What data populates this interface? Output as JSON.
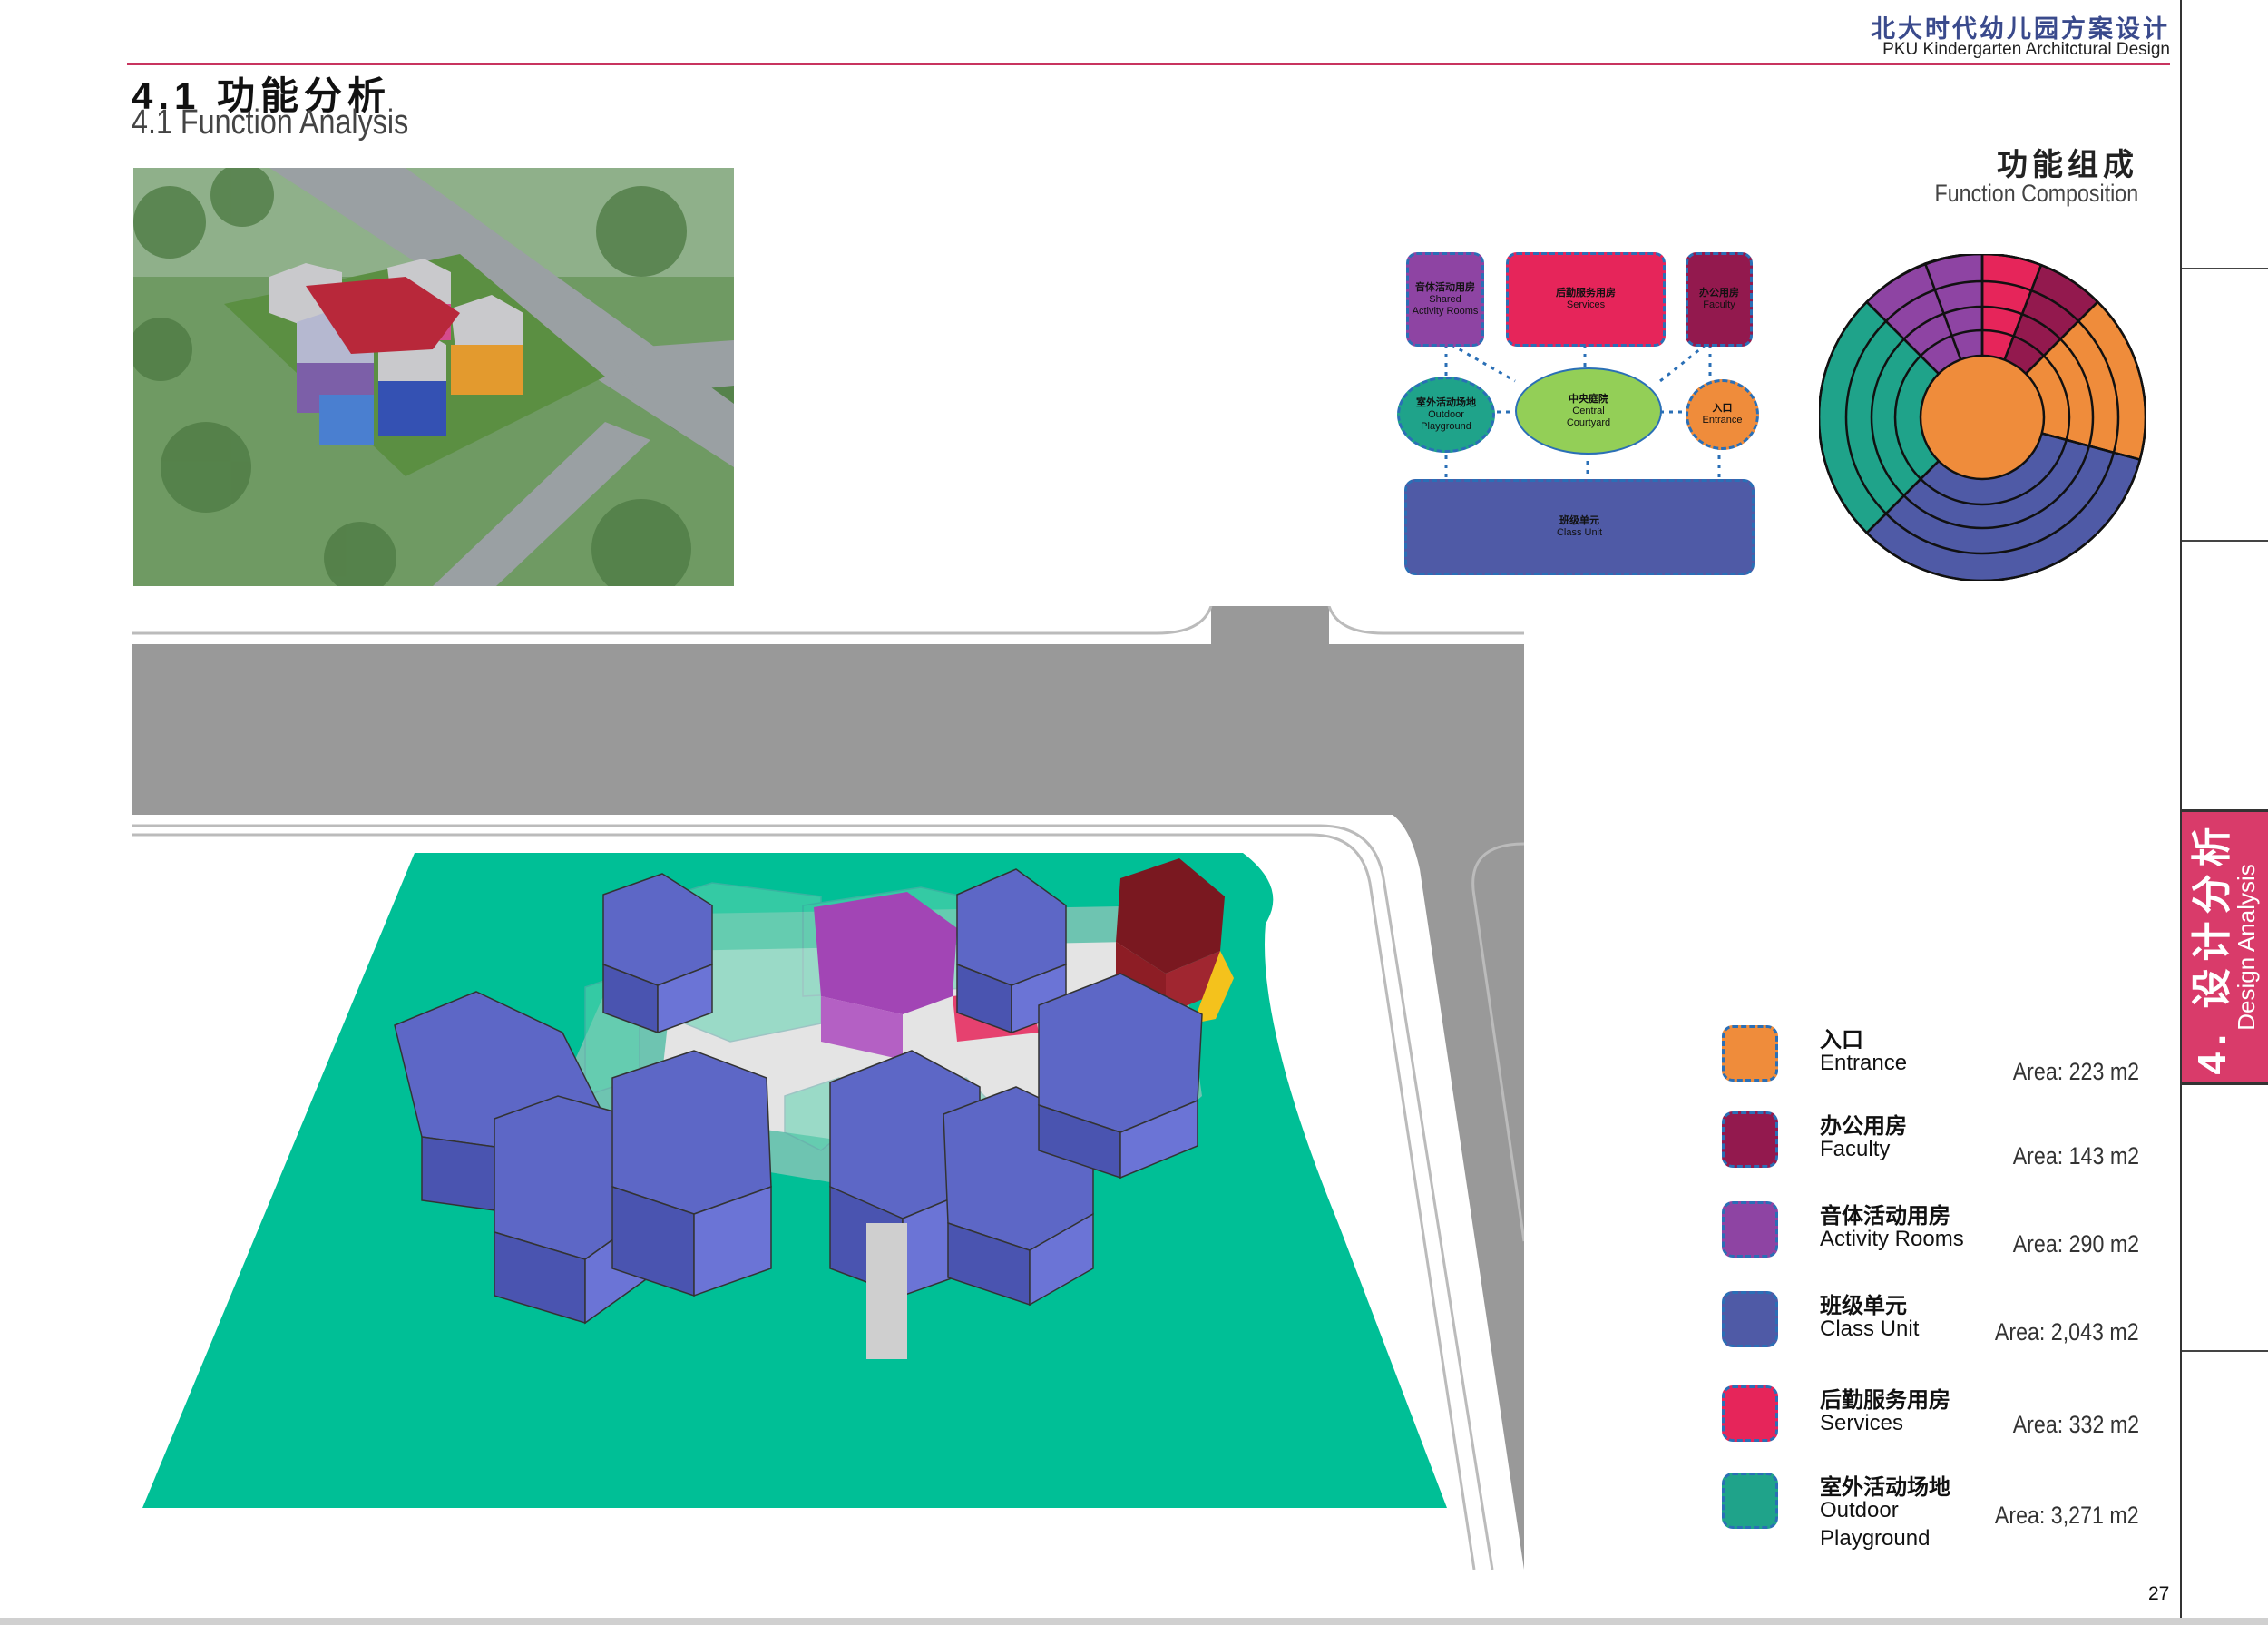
{
  "header": {
    "project_cn": "北大时代幼儿园方案设计",
    "project_en": "PKU  Kindergarten Architctural Design"
  },
  "section": {
    "title_cn": "4.1 功能分析",
    "title_en": "4.1 Function Analysis"
  },
  "side_tab": {
    "cn": "4. 设计分析",
    "en": "Design Analysis",
    "color": "#d93b6a"
  },
  "composition": {
    "title_cn": "功能组成",
    "title_en": "Function Composition"
  },
  "diagram": {
    "activity": {
      "cn": "音体活动用房",
      "en1": "Shared",
      "en2": "Activity Rooms"
    },
    "services": {
      "cn": "后勤服务用房",
      "en": "Services"
    },
    "faculty": {
      "cn": "办公用房",
      "en": "Faculty"
    },
    "outdoor": {
      "cn": "室外活动场地",
      "en1": "Outdoor",
      "en2": "Playground"
    },
    "courtyard": {
      "cn": "中央庭院",
      "en1": "Central",
      "en2": "Courtyard"
    },
    "entrance": {
      "cn": "入口",
      "en": "Entrance"
    },
    "classunit": {
      "cn": "班级单元",
      "en": "Class Unit"
    }
  },
  "colors": {
    "entrance": "#ef8c3b",
    "faculty": "#93194e",
    "activity": "#8e44a3",
    "classunit": "#4f5aa6",
    "services": "#e6255a",
    "outdoor": "#1fa38a",
    "courtyard": "#93cf57",
    "site_green": "#00bf96",
    "road": "#999999"
  },
  "legend": [
    {
      "cn": "入口",
      "en": "Entrance",
      "area": "Area: 223 m2",
      "color": "#ef8c3b"
    },
    {
      "cn": "办公用房",
      "en": "Faculty",
      "area": "Area: 143 m2",
      "color": "#93194e"
    },
    {
      "cn": "音体活动用房",
      "en": "Activity Rooms",
      "area": "Area: 290 m2",
      "color": "#8e44a3"
    },
    {
      "cn": "班级单元",
      "en": "Class Unit",
      "area": "Area: 2,043 m2",
      "color": "#4f5aa6"
    },
    {
      "cn": "后勤服务用房",
      "en": "Services",
      "area": "Area: 332 m2",
      "color": "#e6255a"
    },
    {
      "cn": "室外活动场地",
      "en": "Outdoor Playground",
      "area": "Area: 3,271 m2",
      "color": "#1fa38a"
    }
  ],
  "page_number": "27"
}
